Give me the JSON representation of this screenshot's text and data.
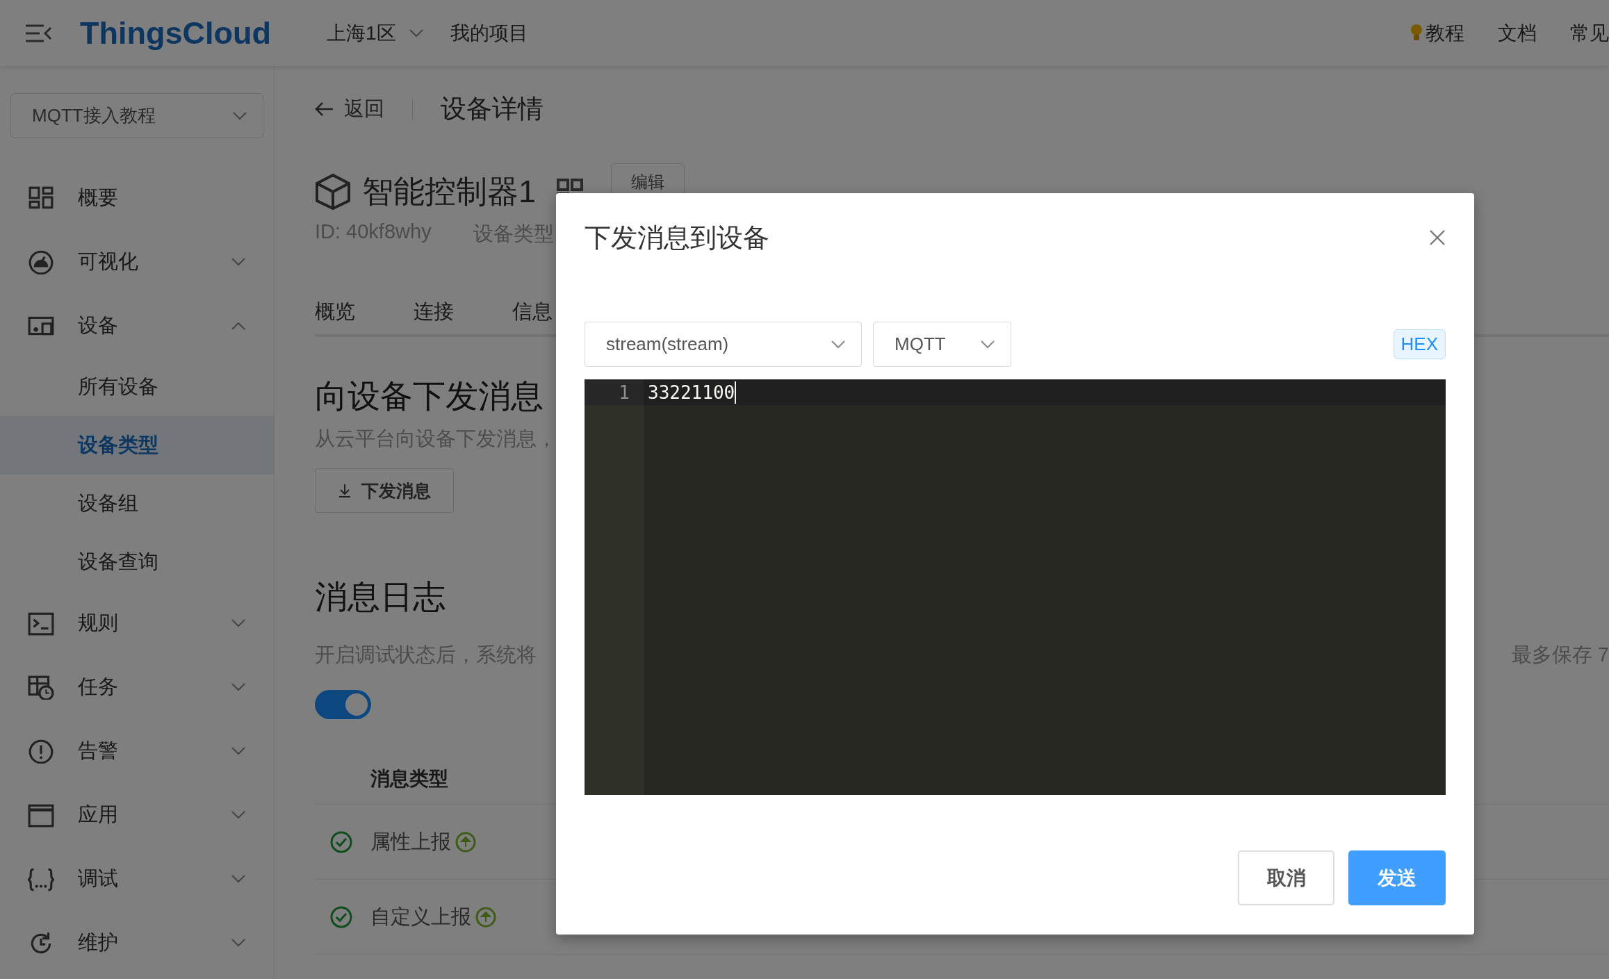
{
  "top_bar": {
    "logo": "ThingsCloud",
    "region": "上海1区",
    "project": "我的项目",
    "links": [
      "教程",
      "文档",
      "常见"
    ]
  },
  "sidebar": {
    "project_select": "MQTT接入教程",
    "items": [
      {
        "label": "概要",
        "kind": "link"
      },
      {
        "label": "可视化",
        "kind": "group",
        "expanded": false
      },
      {
        "label": "设备",
        "kind": "group",
        "expanded": true,
        "children": [
          {
            "label": "所有设备",
            "selected": false
          },
          {
            "label": "设备类型",
            "selected": true
          },
          {
            "label": "设备组",
            "selected": false
          },
          {
            "label": "设备查询",
            "selected": false
          }
        ]
      },
      {
        "label": "规则",
        "kind": "group",
        "expanded": false
      },
      {
        "label": "任务",
        "kind": "group",
        "expanded": false
      },
      {
        "label": "告警",
        "kind": "group",
        "expanded": false
      },
      {
        "label": "应用",
        "kind": "group",
        "expanded": false
      },
      {
        "label": "调试",
        "kind": "group",
        "expanded": false
      },
      {
        "label": "维护",
        "kind": "group",
        "expanded": false
      }
    ]
  },
  "page": {
    "back": "返回",
    "title": "设备详情",
    "device": {
      "name": "智能控制器1",
      "edit_button": "编辑",
      "id": "ID: 40kf8why",
      "type_label": "设备类型"
    },
    "tabs": [
      "概览",
      "连接",
      "信息"
    ],
    "send_section": {
      "title": "向设备下发消息",
      "description": "从云平台向设备下发消息，",
      "button": "下发消息"
    },
    "log_section": {
      "title": "消息日志",
      "description": "开启调试状态后，系统将",
      "retention": "最多保存 7",
      "debug_toggle": {
        "on": true
      },
      "columns": [
        "消息类型"
      ],
      "rows": [
        {
          "type": "属性上报",
          "success": true
        },
        {
          "type": "自定义上报",
          "success": true
        }
      ]
    }
  },
  "dialog": {
    "title": "下发消息到设备",
    "message_type": "stream(stream)",
    "protocol": "MQTT",
    "format_tag": "HEX",
    "editor_lines": [
      {
        "number": "1",
        "text": "33221100"
      }
    ],
    "cancel_button": "取消",
    "send_button": "发送"
  }
}
